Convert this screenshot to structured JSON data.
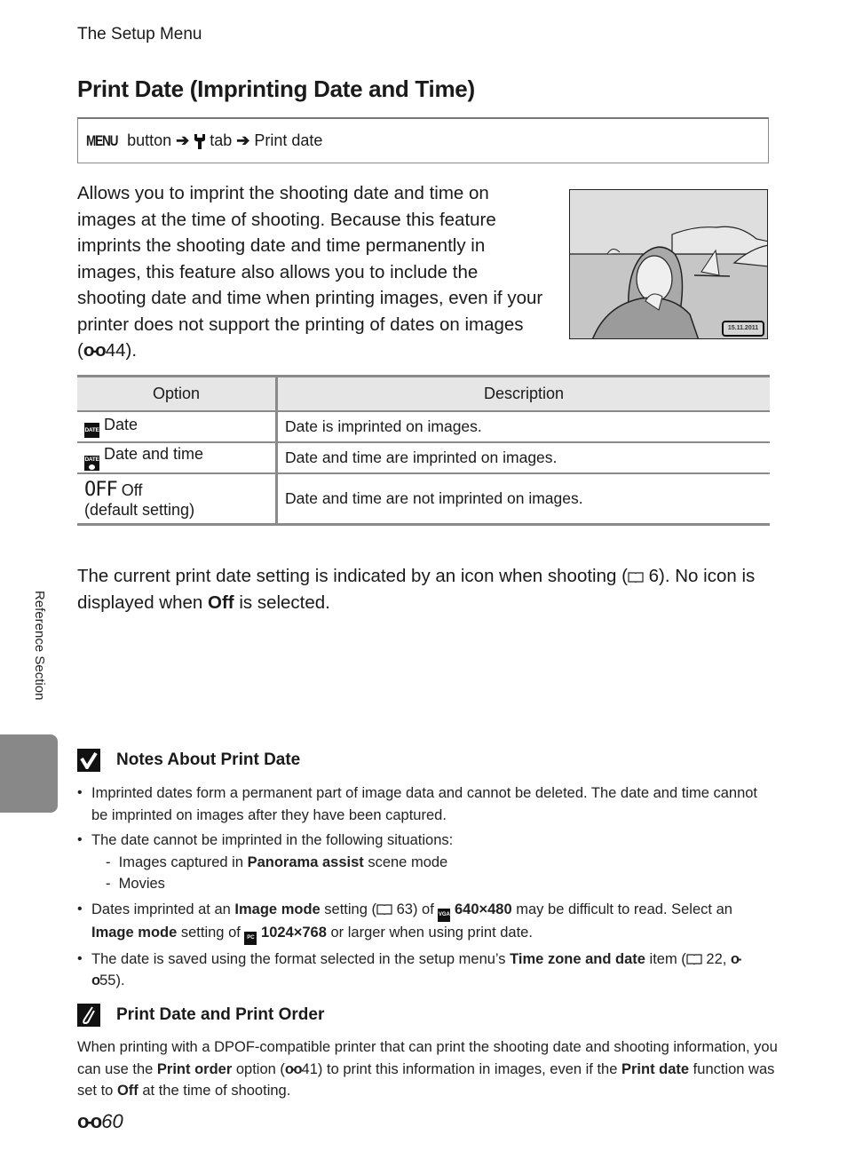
{
  "header": {
    "running_head": "The Setup Menu",
    "title": "Print Date (Imprinting Date and Time)"
  },
  "menu_path": {
    "menu_label": "MENU",
    "button_word": "button",
    "arrow": "➔",
    "tab_icon": "wrench-icon",
    "tab_word": "tab",
    "target": "Print date"
  },
  "intro": {
    "text": "Allows you to imprint the shooting date and time on images at the time of shooting. Because this feature imprints the shooting date and time permanently in images, this feature also allows you to include the shooting date and time when printing images, even if your printer does not support the printing of dates on images (",
    "ref_icon": "binoculars-icon",
    "ref": "44",
    "close": ")."
  },
  "illustration": {
    "date_stamp": "15.11.2011"
  },
  "options_table": {
    "headers": [
      "Option",
      "Description"
    ],
    "rows": [
      {
        "icon": "date-icon",
        "icon_text": "DATE",
        "label": "Date",
        "sub": "",
        "description": "Date is imprinted on images."
      },
      {
        "icon": "date-time-icon",
        "icon_text": "DATE",
        "label": "Date and time",
        "sub": "",
        "description": "Date and time are imprinted on images."
      },
      {
        "icon": "off-icon",
        "icon_text": "OFF",
        "label": "Off",
        "sub": "(default setting)",
        "description": "Date and time are not imprinted on images."
      }
    ]
  },
  "current_setting": {
    "part1": "The current print date setting is indicated by an icon when shooting (",
    "ref": "6",
    "part2": "). No icon is displayed when ",
    "bold": "Off",
    "part3": " is selected."
  },
  "side": {
    "label": "Reference Section"
  },
  "notes": {
    "heading": "Notes About Print Date",
    "b1": "Imprinted dates form a permanent part of image data and cannot be deleted. The date and time cannot be imprinted on images after they have been captured.",
    "b2": "The date cannot be imprinted in the following situations:",
    "b2_sub1_pre": "Images captured in ",
    "b2_sub1_bold": "Panorama assist",
    "b2_sub1_post": " scene mode",
    "b2_sub2": "Movies",
    "b3_pre": "Dates imprinted at an ",
    "b3_bold1": "Image mode",
    "b3_mid1": " setting (",
    "b3_ref": "63",
    "b3_mid2": ") of ",
    "b3_icon1": "VGA",
    "b3_bold2": "640×480",
    "b3_mid3": " may be difficult to read. Select an ",
    "b3_bold3": "Image mode",
    "b3_mid4": " setting of ",
    "b3_icon2": "PC",
    "b3_bold4": "1024×768",
    "b3_post": " or larger when using print date.",
    "b4_pre": "The date is saved using the format selected in the setup menu’s ",
    "b4_bold": "Time zone and date",
    "b4_mid": " item (",
    "b4_ref1": "22",
    "b4_sep": ", ",
    "b4_ref2": "55",
    "b4_post": ")."
  },
  "tip": {
    "heading": "Print Date and Print Order",
    "pre": "When printing with a DPOF-compatible printer that can print the shooting date and shooting information, you can use the ",
    "bold1": "Print order",
    "mid1": " option (",
    "ref": "41",
    "mid2": ") to print this information in images, even if the ",
    "bold2": "Print date",
    "mid3": " function was set to ",
    "bold3": "Off",
    "post": " at the time of shooting."
  },
  "footer": {
    "page_number": "60"
  }
}
